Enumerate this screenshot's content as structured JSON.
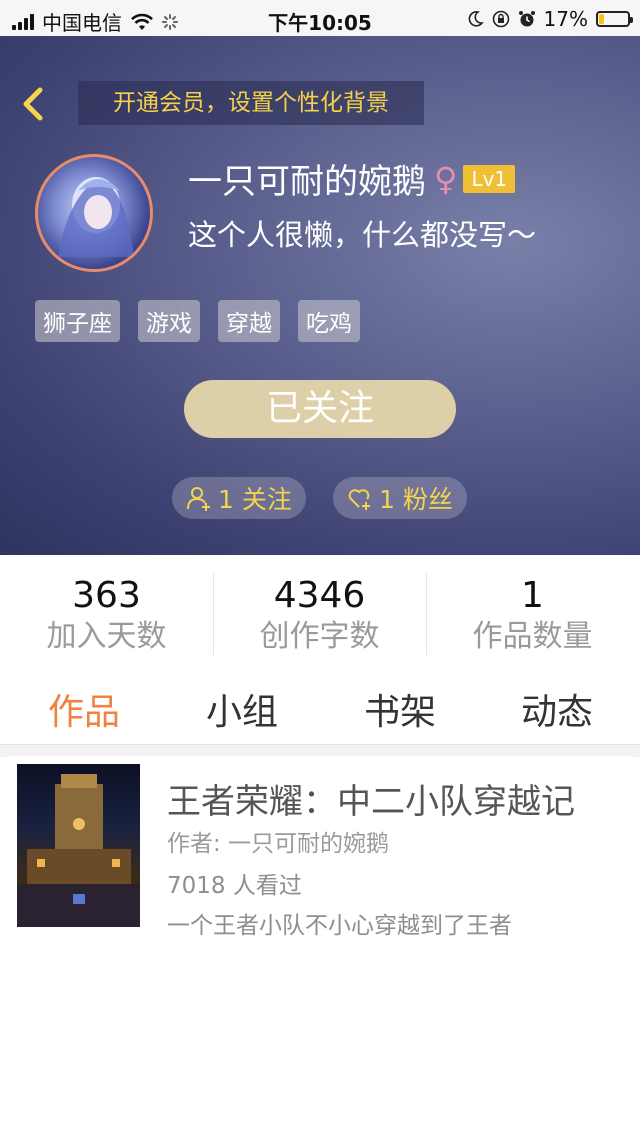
{
  "status_bar": {
    "carrier": "中国电信",
    "time": "下午10:05",
    "battery": "17%",
    "battery_level": 0.17
  },
  "header": {
    "vip_banner": "开通会员，设置个性化背景",
    "username": "一只可耐的婉鹅",
    "gender_symbol": "♀",
    "level": "Lv1",
    "bio": "这个人很懒，什么都没写～",
    "tags": [
      "狮子座",
      "游戏",
      "穿越",
      "吃鸡"
    ],
    "follow_button": "已关注",
    "following": "1 关注",
    "fans": "1 粉丝",
    "accent_color": "#f4d34d"
  },
  "stats": [
    {
      "value": "363",
      "label": "加入天数"
    },
    {
      "value": "4346",
      "label": "创作字数"
    },
    {
      "value": "1",
      "label": "作品数量"
    }
  ],
  "tabs": [
    {
      "label": "作品",
      "active": true
    },
    {
      "label": "小组",
      "active": false
    },
    {
      "label": "书架",
      "active": false
    },
    {
      "label": "动态",
      "active": false
    }
  ],
  "book": {
    "title": "王者荣耀：中二小队穿越记",
    "author": "作者: 一只可耐的婉鹅",
    "views": "7018 人看过",
    "description": "一个王者小队不小心穿越到了王者"
  },
  "colors": {
    "tab_active": "#ef8343",
    "follow_button_bg": "#ddd0a9"
  }
}
